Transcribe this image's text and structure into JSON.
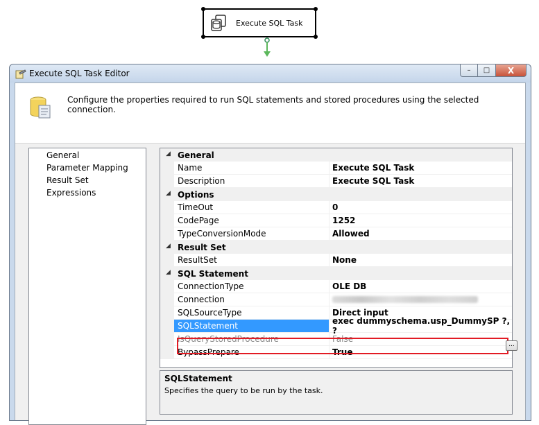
{
  "canvas": {
    "task_label": "Execute SQL Task",
    "icon": "database-task-icon"
  },
  "window": {
    "title": "Execute SQL Task Editor",
    "minimize_label": "–",
    "maximize_label": "□",
    "close_label": "X"
  },
  "banner": {
    "text": "Configure the properties required to run SQL statements and stored procedures using the selected connection.",
    "icon": "database-scroll-icon"
  },
  "nav": {
    "items": [
      "General",
      "Parameter Mapping",
      "Result Set",
      "Expressions"
    ]
  },
  "grid": {
    "categories": {
      "general": "General",
      "options": "Options",
      "result_set": "Result Set",
      "sql_statement": "SQL Statement"
    },
    "rows": {
      "name": {
        "label": "Name",
        "value": "Execute SQL Task"
      },
      "description": {
        "label": "Description",
        "value": "Execute SQL Task"
      },
      "timeout": {
        "label": "TimeOut",
        "value": "0"
      },
      "codepage": {
        "label": "CodePage",
        "value": "1252"
      },
      "typeconversion": {
        "label": "TypeConversionMode",
        "value": "Allowed"
      },
      "resultset": {
        "label": "ResultSet",
        "value": "None"
      },
      "connectiontype": {
        "label": "ConnectionType",
        "value": "OLE DB"
      },
      "connection": {
        "label": "Connection",
        "value": ""
      },
      "sqlsourcetype": {
        "label": "SQLSourceType",
        "value": "Direct input"
      },
      "sqlstatement": {
        "label": "SQLStatement",
        "value": "exec dummyschema.usp_DummySP ?, ?"
      },
      "isquerysp": {
        "label": "IsQueryStoredProcedure",
        "value": "False"
      },
      "bypassprepare": {
        "label": "BypassPrepare",
        "value": "True"
      }
    },
    "ellipsis_label": "..."
  },
  "description_pane": {
    "title": "SQLStatement",
    "text": "Specifies the query to be run by the task."
  },
  "colors": {
    "selection": "#3399ff",
    "highlight_box": "#e21b24",
    "connector": "#5cb85c"
  }
}
